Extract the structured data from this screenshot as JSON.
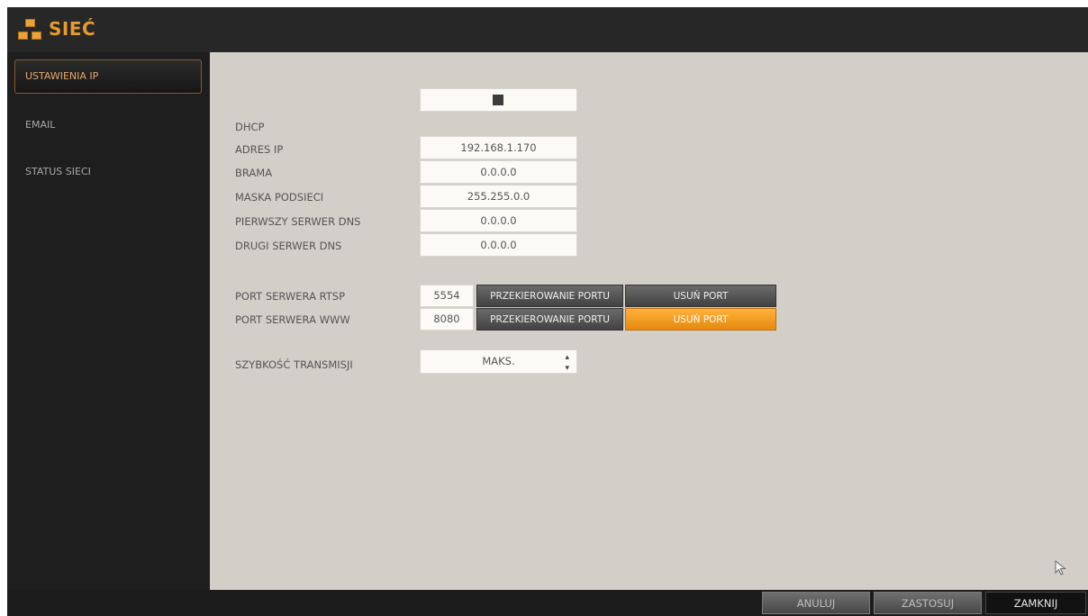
{
  "window": {
    "title": "SIEĆ",
    "logo_icon": "network-icon"
  },
  "sidebar": {
    "items": [
      {
        "label": "USTAWIENIA IP",
        "active": true
      },
      {
        "label": "EMAIL",
        "active": false
      },
      {
        "label": "STATUS SIECI",
        "active": false
      }
    ]
  },
  "form": {
    "dhcp": {
      "label": "DHCP",
      "checked": true
    },
    "ip_address": {
      "label": "ADRES IP",
      "value": "192.168.1.170"
    },
    "gateway": {
      "label": "BRAMA",
      "value": "0.0.0.0"
    },
    "subnet_mask": {
      "label": "MASKA PODSIECI",
      "value": "255.255.0.0"
    },
    "dns1": {
      "label": "PIERWSZY SERWER DNS",
      "value": "0.0.0.0"
    },
    "dns2": {
      "label": "DRUGI SERWER DNS",
      "value": "0.0.0.0"
    },
    "rtsp_port": {
      "label": "PORT SERWERA RTSP",
      "value": "5554",
      "forward_label": "PRZEKIEROWANIE PORTU",
      "remove_label": "USUŃ PORT"
    },
    "www_port": {
      "label": "PORT SERWERA WWW",
      "value": "8080",
      "forward_label": "PRZEKIEROWANIE PORTU",
      "remove_label": "USUŃ PORT"
    },
    "bitrate": {
      "label": "SZYBKOŚĆ TRANSMISJI",
      "value": "MAKS."
    }
  },
  "footer": {
    "cancel_label": "ANULUJ",
    "apply_label": "ZASTOSUJ",
    "close_label": "ZAMKNIJ"
  },
  "colors": {
    "accent": "#e89a2e",
    "content_bg": "#d2cfc9",
    "sidebar_bg": "#1e1e1e"
  }
}
